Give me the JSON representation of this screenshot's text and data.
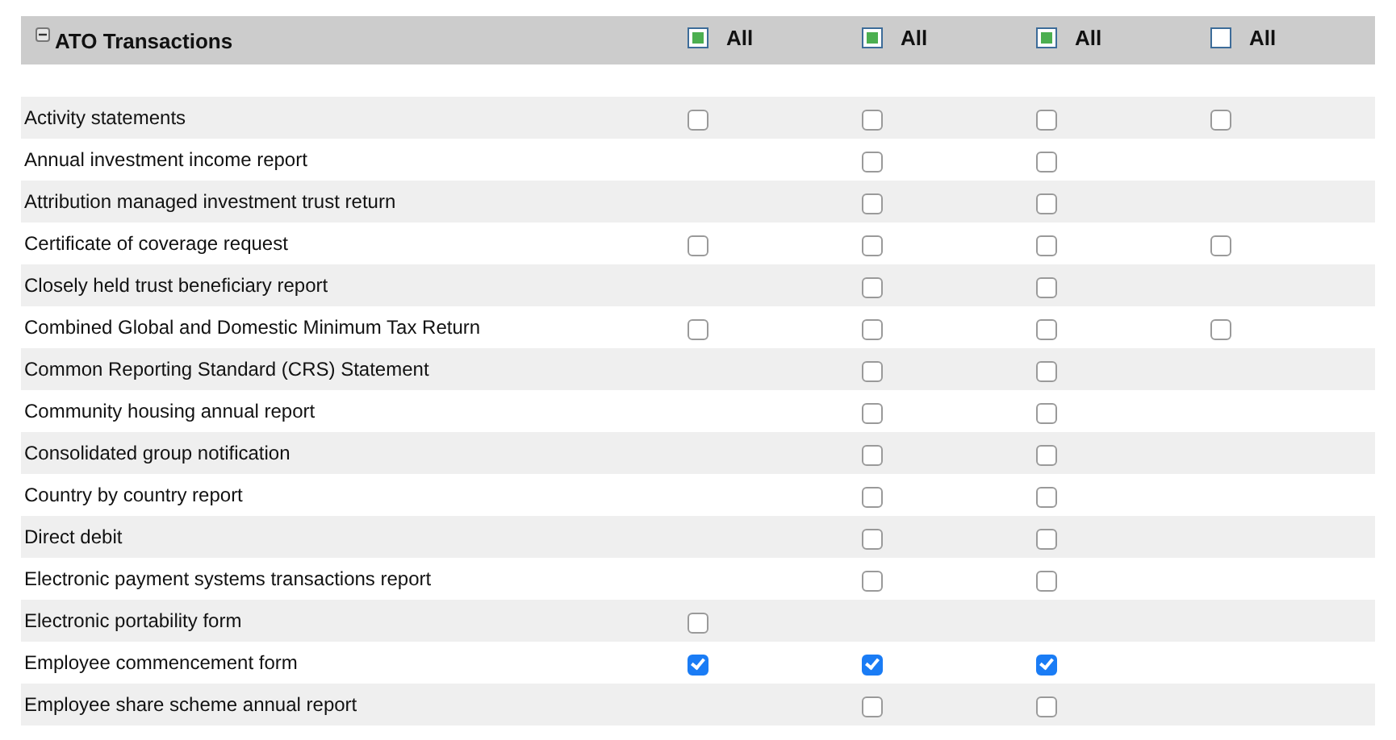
{
  "section": {
    "title": "ATO Transactions",
    "expanded": true,
    "select_all": [
      {
        "label": "All",
        "checked": true
      },
      {
        "label": "All",
        "checked": true
      },
      {
        "label": "All",
        "checked": true
      },
      {
        "label": "All",
        "checked": false
      }
    ]
  },
  "rows": [
    {
      "label": "Activity statements",
      "column_1": {
        "checked": false
      },
      "column_2": {
        "checked": false
      },
      "column_3": {
        "checked": false
      },
      "column_4": {
        "checked": false
      }
    },
    {
      "label": "Annual investment income report",
      "column_2": {
        "checked": false
      },
      "column_3": {
        "checked": false
      }
    },
    {
      "label": "Attribution managed investment trust return",
      "column_2": {
        "checked": false
      },
      "column_3": {
        "checked": false
      }
    },
    {
      "label": "Certificate of coverage request",
      "column_1": {
        "checked": false
      },
      "column_2": {
        "checked": false
      },
      "column_3": {
        "checked": false
      },
      "column_4": {
        "checked": false
      }
    },
    {
      "label": "Closely held trust beneficiary report",
      "column_2": {
        "checked": false
      },
      "column_3": {
        "checked": false
      }
    },
    {
      "label": "Combined Global and Domestic Minimum Tax Return",
      "column_1": {
        "checked": false
      },
      "column_2": {
        "checked": false
      },
      "column_3": {
        "checked": false
      },
      "column_4": {
        "checked": false
      }
    },
    {
      "label": "Common Reporting Standard (CRS) Statement",
      "column_2": {
        "checked": false
      },
      "column_3": {
        "checked": false
      }
    },
    {
      "label": "Community housing annual report",
      "column_2": {
        "checked": false
      },
      "column_3": {
        "checked": false
      }
    },
    {
      "label": "Consolidated group notification",
      "column_2": {
        "checked": false
      },
      "column_3": {
        "checked": false
      }
    },
    {
      "label": "Country by country report",
      "column_2": {
        "checked": false
      },
      "column_3": {
        "checked": false
      }
    },
    {
      "label": "Direct debit",
      "column_2": {
        "checked": false
      },
      "column_3": {
        "checked": false
      }
    },
    {
      "label": "Electronic payment systems transactions report",
      "column_2": {
        "checked": false
      },
      "column_3": {
        "checked": false
      }
    },
    {
      "label": "Electronic portability form",
      "column_1": {
        "checked": false
      }
    },
    {
      "label": "Employee commencement form",
      "column_1": {
        "checked": true
      },
      "column_2": {
        "checked": true
      },
      "column_3": {
        "checked": true
      }
    },
    {
      "label": "Employee share scheme annual report",
      "column_2": {
        "checked": false
      },
      "column_3": {
        "checked": false
      }
    }
  ]
}
